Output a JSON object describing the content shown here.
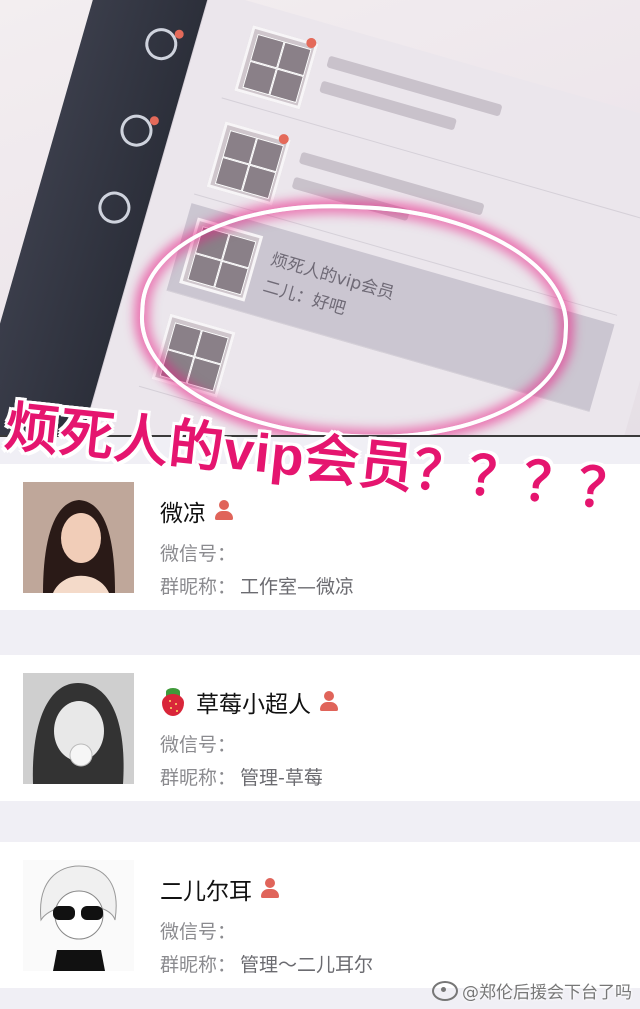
{
  "photo": {
    "highlighted_chat": {
      "title": "烦死人的vip会员",
      "subtitle": "二儿：好吧"
    }
  },
  "caption": "烦死人的vip会员？？？？",
  "members": [
    {
      "name": "微凉",
      "wechat_label": "微信号：",
      "wechat_value": "",
      "group_nick_label": "群昵称：",
      "group_nick_value": "工作室—微凉"
    },
    {
      "name": "草莓小超人",
      "name_prefix_icon": "strawberry-icon",
      "wechat_label": "微信号：",
      "wechat_value": "",
      "group_nick_label": "群昵称：",
      "group_nick_value": "管理-草莓"
    },
    {
      "name": "二儿尔耳",
      "wechat_label": "微信号：",
      "wechat_value": "",
      "group_nick_label": "群昵称：",
      "group_nick_value": "管理～二儿耳尔"
    }
  ],
  "owner_icon": "person-icon",
  "watermark": "@郑伦后援会下台了吗",
  "colors": {
    "caption": "#e5156f",
    "highlight_glow": "#e91c84",
    "owner_icon": "#e0645a",
    "page_bg": "#f0eff5"
  }
}
